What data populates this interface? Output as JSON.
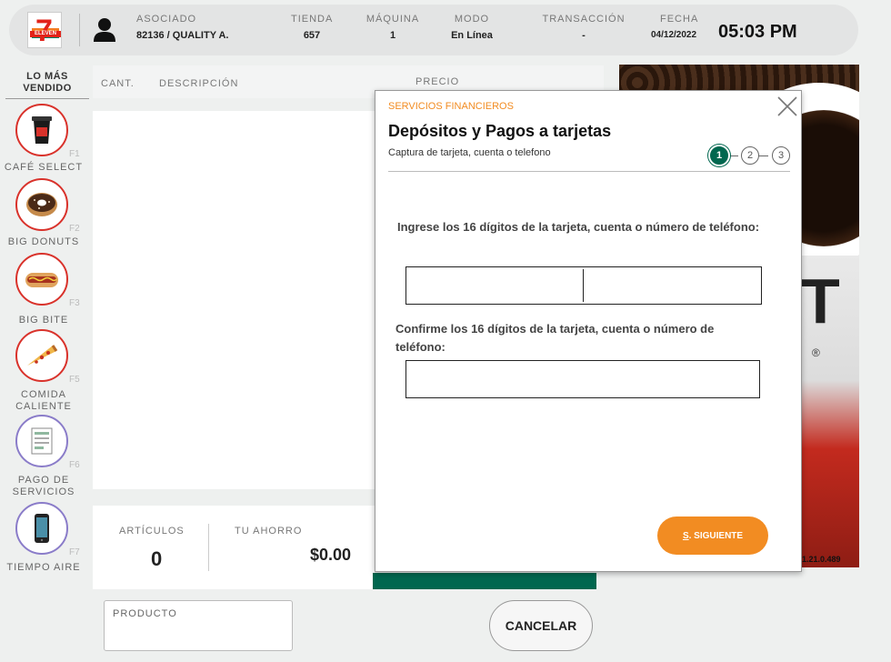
{
  "header": {
    "logo_text": "ELEVEN",
    "logo_digit": "7",
    "asociado_label": "ASOCIADO",
    "asociado_value": "82136  / QUALITY A.",
    "tienda_label": "TIENDA",
    "tienda_value": "657",
    "maquina_label": "MÁQUINA",
    "maquina_value": "1",
    "modo_label": "MODO",
    "modo_value": "En Línea",
    "transaccion_label": "TRANSACCIÓN",
    "transaccion_value": "-",
    "fecha_label": "FECHA",
    "fecha_value": "04/12/2022",
    "time": "05:03 PM"
  },
  "sidebar": {
    "title_line1": "LO MÁS",
    "title_line2": "VENDIDO",
    "items": [
      {
        "label": "CAFÉ SELECT",
        "key": "F1"
      },
      {
        "label": "BIG DONUTS",
        "key": "F2"
      },
      {
        "label": "BIG BITE",
        "key": "F3"
      },
      {
        "label_line1": "COMIDA",
        "label_line2": "CALIENTE",
        "key": "F5"
      },
      {
        "label_line1": "PAGO DE",
        "label_line2": "SERVICIOS",
        "key": "F6"
      },
      {
        "label": "TIEMPO AIRE",
        "key": "F7"
      }
    ]
  },
  "grid": {
    "col_qty": "CANT.",
    "col_desc": "DESCRIPCIÓN",
    "col_price": "PRECIO"
  },
  "totals": {
    "articles_label": "ARTÍCULOS",
    "articles_value": "0",
    "savings_label": "TU AHORRO",
    "savings_value": "$0.00"
  },
  "product_label": "PRODUCTO",
  "cancel_label": "CANCELAR",
  "version": "1.21.0.489",
  "modal": {
    "category": "SERVICIOS FINANCIEROS",
    "title": "Depósitos y Pagos a tarjetas",
    "subtitle": "Captura de tarjeta, cuenta o telefono",
    "steps": [
      "1",
      "2",
      "3"
    ],
    "field1_label": "Ingrese los 16 dígitos de la tarjeta, cuenta o número de teléfono:",
    "field1_value": "",
    "field2_label": "Confirme los 16 dígitos de la tarjeta, cuenta o número de teléfono:",
    "field2_value": "",
    "next_key": "S",
    "next_label": ". SIGUIENTE"
  },
  "colors": {
    "brand_green": "#00674f",
    "brand_orange": "#f28c22",
    "brand_red": "#e2231a"
  },
  "ad": {
    "big_letter": "T",
    "reg_mark": "®"
  }
}
